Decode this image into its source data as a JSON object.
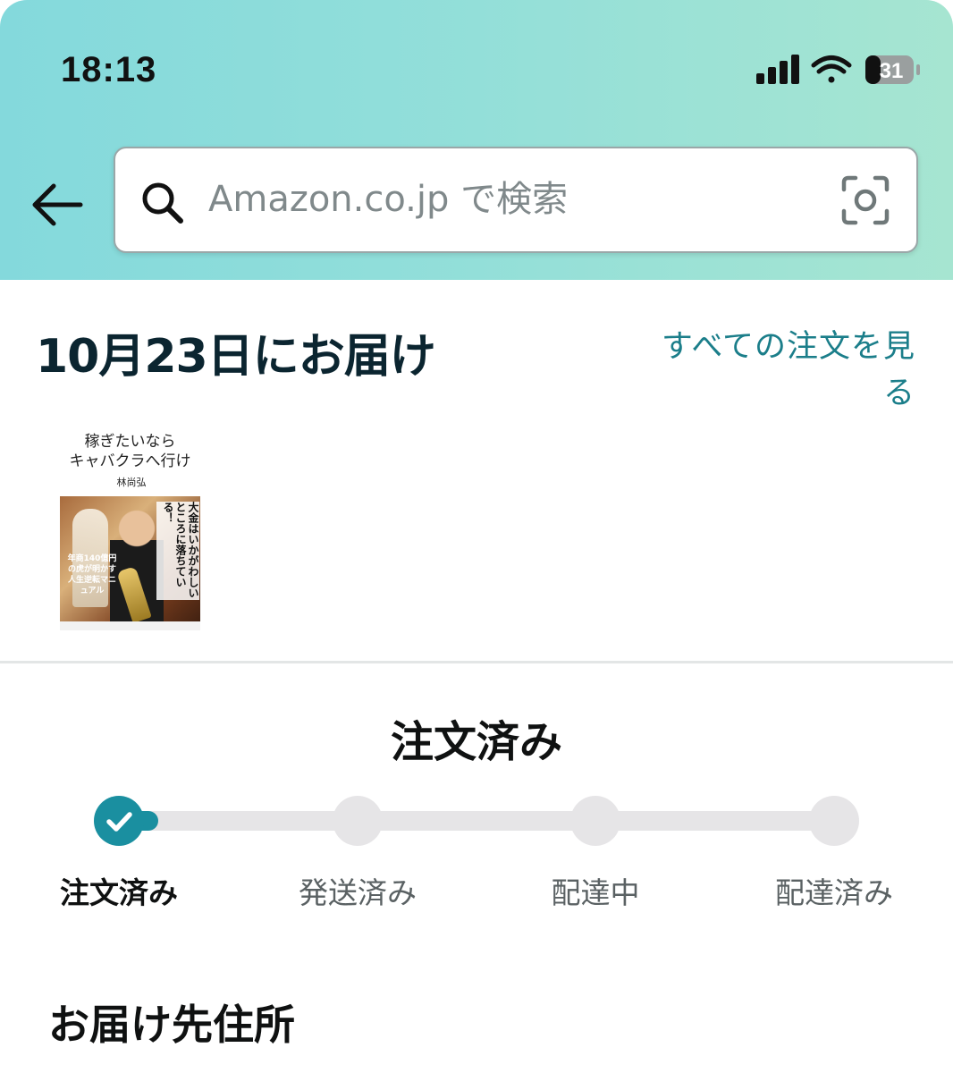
{
  "status_bar": {
    "time": "18:13",
    "battery_level": "31",
    "signal_icon": "signal-icon",
    "wifi_icon": "wifi-icon",
    "battery_icon": "battery-icon"
  },
  "header": {
    "back_icon": "back-arrow-icon",
    "search_placeholder": "Amazon.co.jp で検索",
    "search_value": "",
    "search_icon": "search-icon",
    "camera_icon": "camera-icon",
    "gradient_colors": [
      "#84d9dc",
      "#a6e5d1"
    ]
  },
  "delivery": {
    "title": "10月23日にお届け",
    "all_orders_link": "すべての注文を見る"
  },
  "product": {
    "book_title_line1": "稼ぎたいなら",
    "book_title_line2": "キャバクラへ行け",
    "book_author": "林尚弘",
    "cover_tagline": "大金はいかがわしいところに落ちている！",
    "cover_caption": "年商140億円の虎が明かす人生逆転マニュアル"
  },
  "order_status": {
    "title": "注文済み",
    "current_step": 1,
    "total_steps": 4,
    "steps": [
      {
        "label": "注文済み",
        "state": "done"
      },
      {
        "label": "発送済み",
        "state": "pending"
      },
      {
        "label": "配達中",
        "state": "pending"
      },
      {
        "label": "配達済み",
        "state": "pending"
      }
    ],
    "accent_color": "#1a8fa0",
    "inactive_color": "#e6e5e7"
  },
  "address": {
    "title": "お届け先住所"
  }
}
